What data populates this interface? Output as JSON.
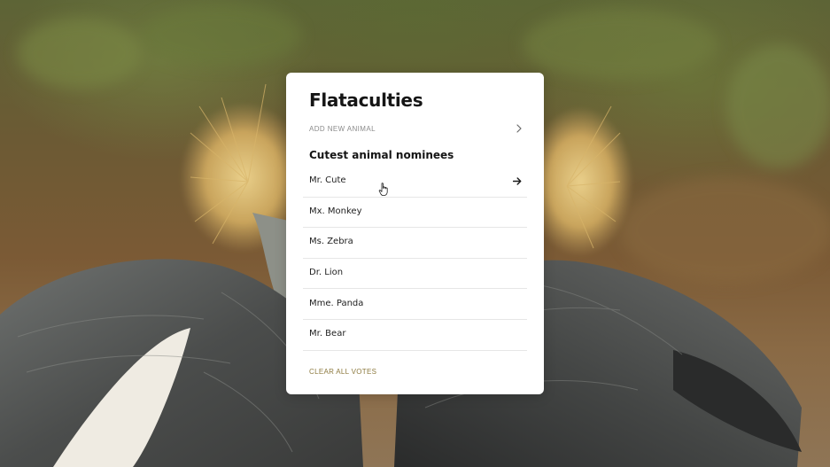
{
  "background": {
    "description_icon": "crowned-crane-photo-icon"
  },
  "card": {
    "title": "Flataculties",
    "add_new_label": "ADD NEW ANIMAL",
    "section_title": "Cutest animal nominees",
    "nominees": [
      {
        "name": "Mr. Cute",
        "hovered": true
      },
      {
        "name": "Mx. Monkey"
      },
      {
        "name": "Ms. Zebra"
      },
      {
        "name": "Dr. Lion"
      },
      {
        "name": "Mme. Panda"
      },
      {
        "name": "Mr. Bear"
      }
    ],
    "clear_votes_label": "CLEAR ALL VOTES"
  },
  "colors": {
    "card_bg": "#ffffff",
    "title": "#151515",
    "muted": "#8b8b8b",
    "accent": "#8d7a3f",
    "divider": "#e6e6e6"
  }
}
